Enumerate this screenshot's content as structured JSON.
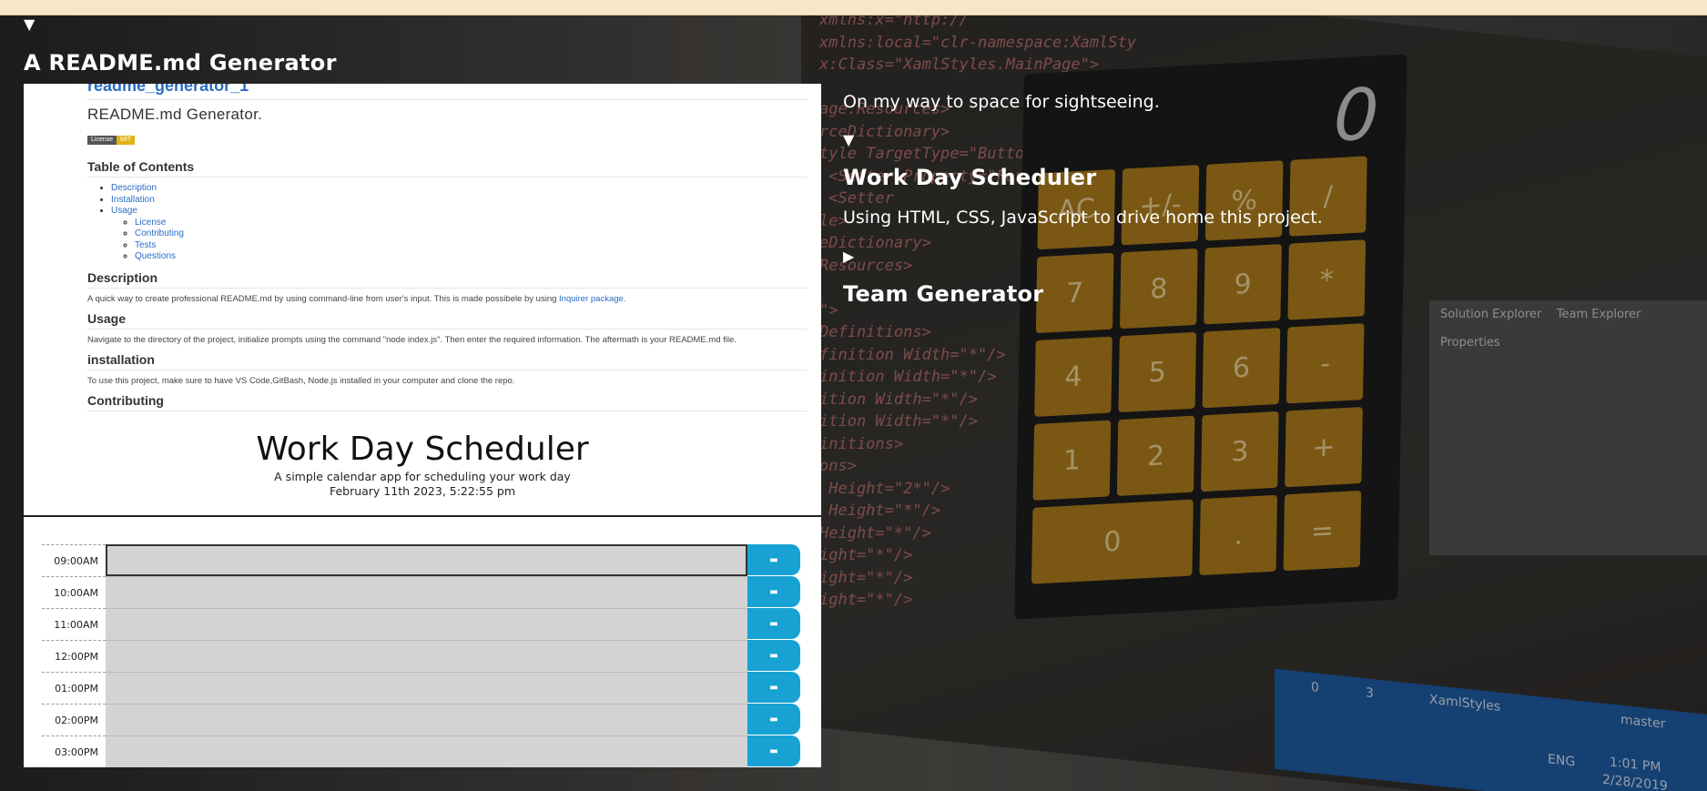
{
  "projects": [
    {
      "title": "A README.md Generator",
      "description": "On my way to space for sightseeing.",
      "expanded": true
    },
    {
      "title": "Work Day Scheduler",
      "description": "Using HTML, CSS, JavaScript to drive home this project.",
      "expanded": true
    },
    {
      "title": "Team Generator",
      "expanded": false
    }
  ],
  "readme_preview": {
    "repo_name": "readme_generator_1",
    "heading": "README.md Generator.",
    "badge_left": "License",
    "badge_right": "MIT",
    "toc_title": "Table of Contents",
    "toc": [
      "Description",
      "Installation",
      "Usage"
    ],
    "toc_sub": [
      "License",
      "Contributing",
      "Tests",
      "Questions"
    ],
    "description_title": "Description",
    "description_text": "A quick way to create professional README.md by using command-line from user's input. This is made possibele by using",
    "description_link": "Inquirer package.",
    "usage_title": "Usage",
    "usage_text": "Navigate to the directory of the project, initialize prompts using the command \"node index.js\". Then enter the required information. The aftermath is your README.md file.",
    "installation_title": "installation",
    "installation_text": "To use this project, make sure to have VS Code,GitBash, Node.js installed in your computer and clone the repo.",
    "next_title": "Contributing"
  },
  "scheduler_preview": {
    "title": "Work Day Scheduler",
    "subtitle": "A simple calendar app for scheduling your work day",
    "date": "February 11th 2023, 5:22:55 pm",
    "hours": [
      "09:00AM",
      "10:00AM",
      "11:00AM",
      "12:00PM",
      "01:00PM",
      "02:00PM",
      "03:00PM"
    ],
    "save_icon": "save-icon"
  },
  "background": {
    "code_lines": [
      "xmlns:x=\"http://",
      "xmlns:local=\"clr-namespace:XamlSty",
      "x:Class=\"XamlStyles.MainPage\">",
      "",
      "age.Resources>",
      "rceDictionary>",
      "tyle TargetType=\"Button\">",
      " <Setter Property=\"FontSize\" Va",
      " <Setter",
      "le>",
      "eDictionary>",
      "Resources>",
      "",
      "\">",
      "Definitions>",
      "finition Width=\"*\"/>",
      "inition Width=\"*\"/>",
      "ition Width=\"*\"/>",
      "ition Width=\"*\"/>",
      "initions>",
      "ons>",
      " Height=\"2*\"/>",
      " Height=\"*\"/>",
      "Height=\"*\"/>",
      "ight=\"*\"/>",
      "ight=\"*\"/>",
      "ight=\"*\"/>"
    ],
    "calc_display": "0",
    "calc_keys": [
      "AC",
      "+/-",
      "%",
      "/",
      "7",
      "8",
      "9",
      "*",
      "4",
      "5",
      "6",
      "-",
      "1",
      "2",
      "3",
      "+",
      "0",
      ".",
      "="
    ],
    "panel_tabs": [
      "Solution Explorer",
      "Team Explorer"
    ],
    "panel_properties": "Properties",
    "taskbar": {
      "lang": "ENG",
      "time": "1:01 PM",
      "date": "2/28/2019",
      "branch": "master",
      "repo": "XamlStyles",
      "up": "0",
      "edits": "3"
    }
  },
  "colors": {
    "save_button": "#17a2d3",
    "calc_key": "#b4821e",
    "bookmarks_bar": "#f6e8c6"
  }
}
